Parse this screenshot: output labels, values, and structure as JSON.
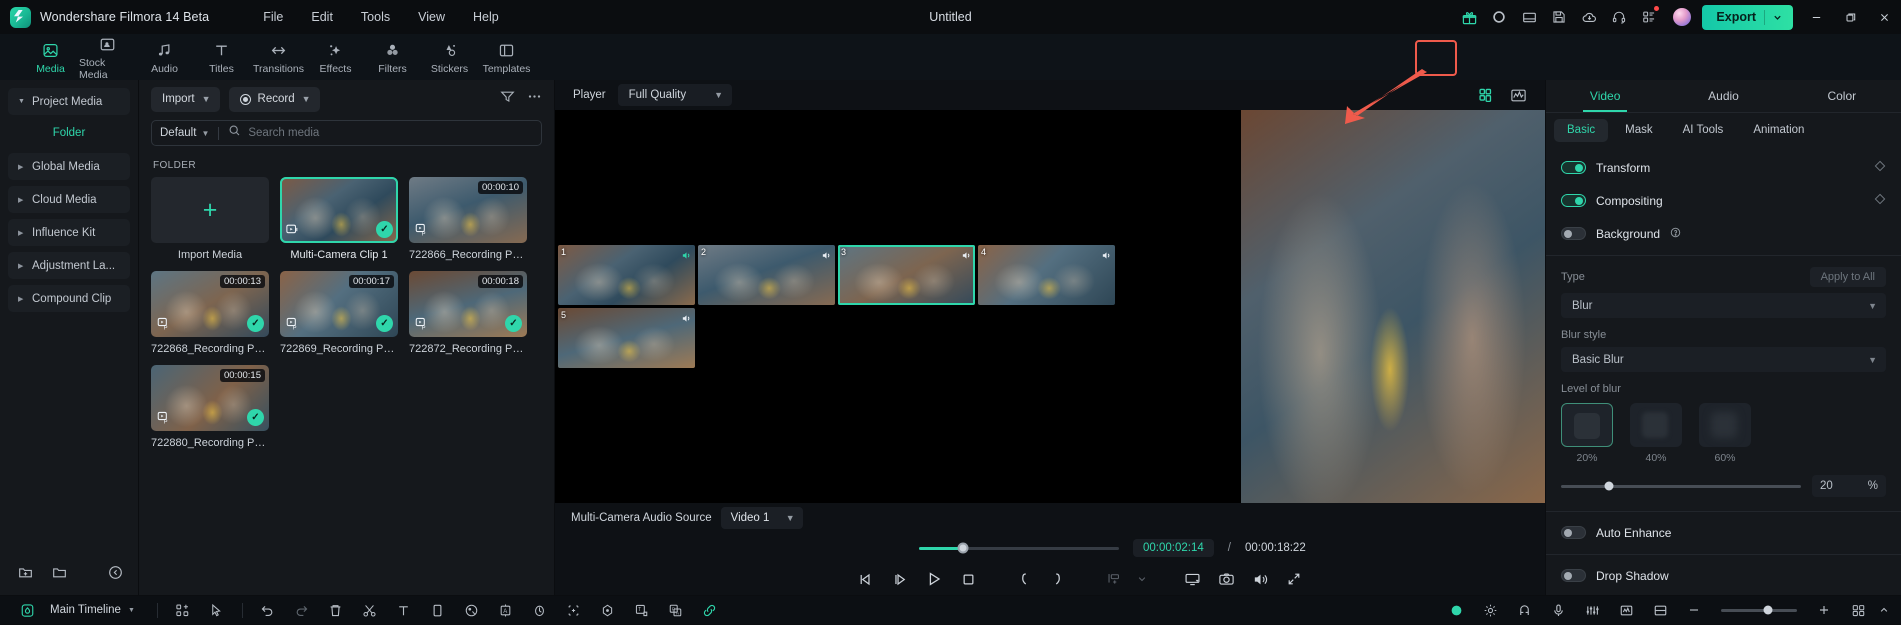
{
  "app": {
    "brand": "Wondershare Filmora 14 Beta",
    "document_title": "Untitled",
    "menu": [
      "File",
      "Edit",
      "Tools",
      "View",
      "Help"
    ],
    "titlebar_icons": [
      "gift-icon",
      "record-circle-icon",
      "layout-icon",
      "save-icon",
      "cloud-upload-icon",
      "headset-icon",
      "apps-grid-icon"
    ],
    "export_label": "Export",
    "window_controls": [
      "minimize",
      "restore",
      "close"
    ]
  },
  "tooltabs": [
    {
      "label": "Media",
      "icon": "media-icon",
      "active": true
    },
    {
      "label": "Stock Media",
      "icon": "stock-media-icon",
      "active": false
    },
    {
      "label": "Audio",
      "icon": "audio-note-icon",
      "active": false
    },
    {
      "label": "Titles",
      "icon": "titles-text-icon",
      "active": false
    },
    {
      "label": "Transitions",
      "icon": "transitions-arrow-icon",
      "active": false
    },
    {
      "label": "Effects",
      "icon": "effects-sparkle-icon",
      "active": false
    },
    {
      "label": "Filters",
      "icon": "filters-circles-icon",
      "active": false
    },
    {
      "label": "Stickers",
      "icon": "stickers-icon",
      "active": false
    },
    {
      "label": "Templates",
      "icon": "templates-layout-icon",
      "active": false
    }
  ],
  "leftnav": {
    "items": [
      {
        "label": "Project Media",
        "expanded": true,
        "highlighted": true
      },
      {
        "label": "Global Media",
        "expanded": false,
        "highlighted": true
      },
      {
        "label": "Cloud Media",
        "expanded": false,
        "highlighted": true
      },
      {
        "label": "Influence Kit",
        "expanded": false,
        "highlighted": true
      },
      {
        "label": "Adjustment La...",
        "expanded": false,
        "highlighted": true
      },
      {
        "label": "Compound Clip",
        "expanded": false,
        "highlighted": true
      }
    ],
    "subitem": "Folder",
    "footer_icons": [
      "new-folder-icon",
      "folder-icon",
      "collapse-left-icon"
    ]
  },
  "media": {
    "import_label": "Import",
    "record_label": "Record",
    "sort_label": "Default",
    "search_placeholder": "Search media",
    "search_value": "",
    "filter_icon": "filter-icon",
    "more_icon": "more-options-icon",
    "section_label": "FOLDER",
    "items": [
      {
        "name": "Import Media",
        "type": "add",
        "duration": "",
        "checked": false,
        "selected": false
      },
      {
        "name": "Multi-Camera Clip 1",
        "type": "multicam",
        "duration": "",
        "checked": true,
        "selected": true
      },
      {
        "name": "722866_Recording Po...",
        "type": "video",
        "duration": "00:00:10",
        "checked": false,
        "selected": false
      },
      {
        "name": "722868_Recording Po...",
        "type": "video",
        "duration": "00:00:13",
        "checked": true,
        "selected": false
      },
      {
        "name": "722869_Recording Po...",
        "type": "video",
        "duration": "00:00:17",
        "checked": true,
        "selected": false
      },
      {
        "name": "722872_Recording Po...",
        "type": "video",
        "duration": "00:00:18",
        "checked": true,
        "selected": false
      },
      {
        "name": "722880_Recording Po...",
        "type": "video",
        "duration": "00:00:15",
        "checked": true,
        "selected": false
      }
    ]
  },
  "player": {
    "label": "Player",
    "quality": "Full Quality",
    "grid_view_icon": "multicam-grid-icon",
    "waveform_icon": "audio-waveform-icon",
    "multicam_cells": [
      {
        "num": "1",
        "audio": "on",
        "selected": false
      },
      {
        "num": "2",
        "audio": "off",
        "selected": false
      },
      {
        "num": "3",
        "audio": "off",
        "selected": true
      },
      {
        "num": "4",
        "audio": "off",
        "selected": false
      },
      {
        "num": "5",
        "audio": "off",
        "selected": false
      }
    ],
    "audio_source_label": "Multi-Camera Audio Source",
    "audio_source_value": "Video 1",
    "current_time": "00:00:02:14",
    "time_separator": "/",
    "total_time": "00:00:18:22",
    "progress_percent": 22,
    "transport_icons": [
      "previous-frame-icon",
      "next-frame-icon",
      "play-icon",
      "stop-icon",
      "mark-in-icon",
      "mark-out-icon",
      "add-to-timeline-icon",
      "chevron-down-icon",
      "screen-record-icon",
      "snapshot-icon",
      "volume-icon",
      "fullscreen-icon"
    ]
  },
  "rightpanel": {
    "tabs": [
      {
        "label": "Video",
        "active": true
      },
      {
        "label": "Audio",
        "active": false
      },
      {
        "label": "Color",
        "active": false
      }
    ],
    "subtabs": [
      {
        "label": "Basic",
        "active": true
      },
      {
        "label": "Mask",
        "active": false
      },
      {
        "label": "AI Tools",
        "active": false
      },
      {
        "label": "Animation",
        "active": false
      }
    ],
    "toggles": [
      {
        "label": "Transform",
        "on": true,
        "keyframe": true,
        "help": false
      },
      {
        "label": "Compositing",
        "on": true,
        "keyframe": true,
        "help": false
      },
      {
        "label": "Background",
        "on": false,
        "keyframe": false,
        "help": true
      }
    ],
    "type_label": "Type",
    "apply_all_label": "Apply to All",
    "type_value": "Blur",
    "blur_style_label": "Blur style",
    "blur_style_value": "Basic Blur",
    "level_label": "Level of blur",
    "levels": [
      {
        "pct": "20%",
        "selected": true
      },
      {
        "pct": "40%",
        "selected": false
      },
      {
        "pct": "60%",
        "selected": false
      }
    ],
    "slider_value": "20",
    "slider_unit": "%",
    "slider_percent": 20,
    "extra_toggles": [
      {
        "label": "Auto Enhance",
        "on": false
      },
      {
        "label": "Drop Shadow",
        "on": false
      }
    ]
  },
  "bottombar": {
    "timeline_name": "Main Timeline",
    "left_icons": [
      "render-preview-icon",
      "select-tool-icon",
      "pointer-tool-icon"
    ],
    "edit_icons": [
      "undo-icon",
      "redo-icon",
      "delete-icon",
      "split-scissors-icon",
      "text-icon",
      "crop-icon",
      "speed-icon",
      "color-match-icon",
      "keyframe-icon",
      "mask-icon",
      "stabilize-icon",
      "auto-reframe-icon",
      "link-icon"
    ],
    "right_icons": [
      "marker-icon",
      "settings-icon",
      "magnet-icon",
      "mic-icon",
      "audio-mix-icon",
      "beat-detect-icon",
      "silence-detect-icon",
      "screen-split-icon",
      "zoom-out-icon",
      "zoom-in-icon",
      "grid-toggle-icon",
      "chevron-up-icon"
    ],
    "zoom_percent": 62
  },
  "annotation": {
    "highlight_target": "multicam-grid-view-button",
    "arrow_color": "#ef5b4c",
    "box_color": "#ef5b4c"
  }
}
